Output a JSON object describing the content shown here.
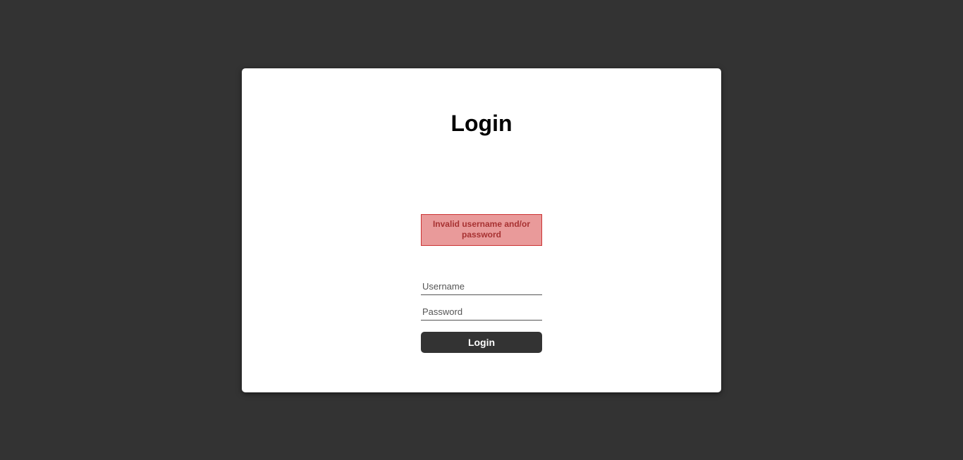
{
  "login": {
    "title": "Login",
    "error_message": "Invalid username and/or password",
    "username_placeholder": "Username",
    "password_placeholder": "Password",
    "username_value": "",
    "password_value": "",
    "button_label": "Login"
  }
}
